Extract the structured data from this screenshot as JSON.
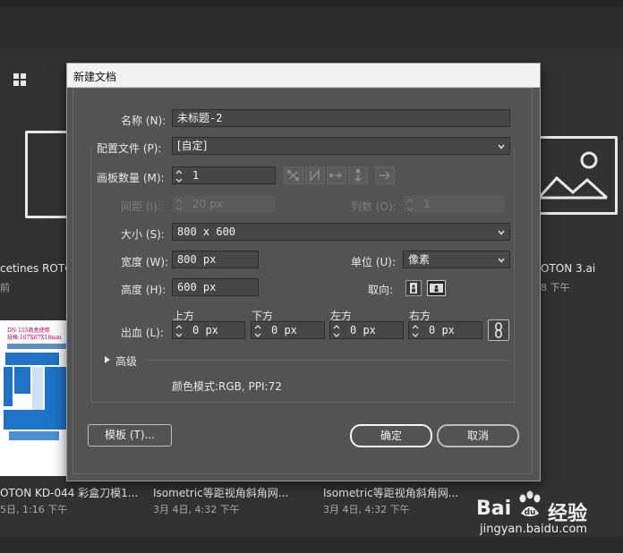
{
  "background": {
    "files": [
      {
        "name": "cetines ROTO",
        "date": "前"
      },
      {
        "name": "OTON 3.ai",
        "date": "8 下午"
      },
      {
        "name": "OTON KD-044 彩盒刀模1...",
        "date": "5日, 1:16 下午"
      },
      {
        "name": "Isometric等距视角斜角网...",
        "date": "3月 4日, 4:32 下午"
      },
      {
        "name": "Isometric等距视角斜角网...",
        "date": "3月 4日, 4:32 下午"
      }
    ],
    "doc_thumb_text": [
      "DN-155商盒使用",
      "规格:107X67X16mm"
    ]
  },
  "dialog": {
    "title": "新建文档",
    "name_label": "名称 (N):",
    "name_value": "未标题-2",
    "profile_label": "配置文件 (P):",
    "profile_value": "[自定]",
    "artboards_label": "画板数量 (M):",
    "artboards_value": "1",
    "spacing_label": "间距 (I):",
    "spacing_value": "20 px",
    "columns_label": "列数 (O):",
    "columns_value": "1",
    "size_label": "大小 (S):",
    "size_value": "800 x 600",
    "width_label": "宽度 (W):",
    "width_value": "800 px",
    "units_label": "单位 (U):",
    "units_value": "像素",
    "height_label": "高度 (H):",
    "height_value": "600 px",
    "orientation_label": "取向:",
    "bleed_label": "出血 (L):",
    "bleed": [
      {
        "label": "上方",
        "value": "0 px"
      },
      {
        "label": "下方",
        "value": "0 px"
      },
      {
        "label": "左方",
        "value": "0 px"
      },
      {
        "label": "右方",
        "value": "0 px"
      }
    ],
    "advanced_label": "高级",
    "color_mode_text": "颜色模式:RGB, PPI:72",
    "templates_button": "模板 (T)...",
    "ok_button": "确定",
    "cancel_button": "取消"
  },
  "watermark": {
    "brand_a": "Bai",
    "brand_b": "经验",
    "url": "jingyan.baidu.com"
  }
}
